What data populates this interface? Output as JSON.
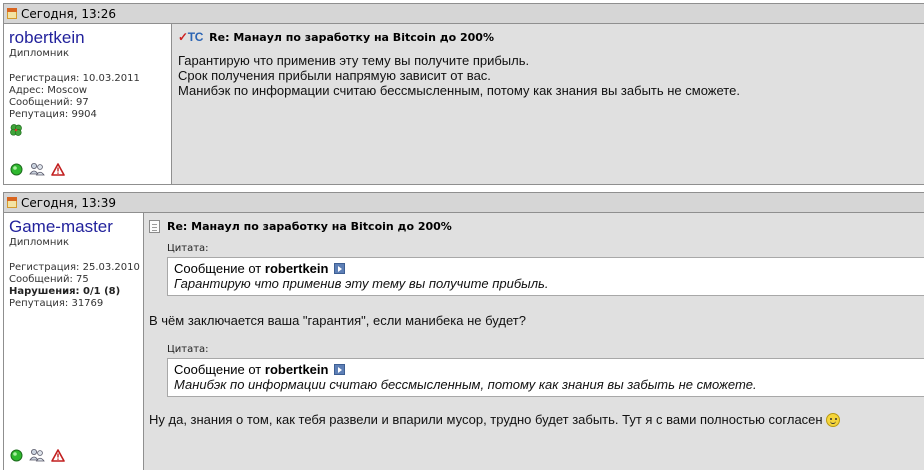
{
  "posts": [
    {
      "date": "Сегодня, 13:26",
      "username": "robertkein",
      "usertitle": "Дипломник",
      "stats": {
        "registration": "Регистрация: 10.03.2011",
        "address": "Адрес: Moscow",
        "messages": "Сообщений: 97",
        "reputation": "Репутация: 9904"
      },
      "tc_mark": "TC",
      "title": "Re: Манaул по заработку на Bitcoin до 200%",
      "lines": [
        "Гарантирую что применив эту тему вы получите прибыль.",
        "Срок получения прибыли напрямую зависит от вас.",
        "Манибэк по информации считаю бессмысленным, потому как знания вы забыть не сможете."
      ]
    },
    {
      "date": "Сегодня, 13:39",
      "username": "Game-master",
      "usertitle": "Дипломник",
      "stats": {
        "registration": "Регистрация: 25.03.2010",
        "messages": "Сообщений: 75",
        "violations": "Нарушения: 0/1 (8)",
        "reputation": "Репутация: 31769"
      },
      "title": "Re: Манaул по заработку на Bitcoin до 200%",
      "quote1": {
        "label": "Цитата:",
        "prefix": "Сообщение от",
        "author": "robertkein",
        "text": "Гарантирую что применив эту тему вы получите прибыль."
      },
      "text1": "В чём заключается ваша \"гарантия\", если манибека не будет?",
      "quote2": {
        "label": "Цитата:",
        "prefix": "Сообщение от",
        "author": "robertkein",
        "text": "Манибэк по информации считаю бессмысленным, потому как знания вы забыть не сможете."
      },
      "text2": "Ну да, знания о том, как тебя развели и впарили мусор, трудно будет забыть. Тут я с вами полностью согласен"
    }
  ],
  "icons": {
    "online": "online-status-icon",
    "users": "users-icon",
    "report": "report-warning-icon",
    "reputation": "reputation-clover-icon",
    "smiley": "smiley-icon"
  },
  "colors": {
    "header_bg": "#d6d6d6",
    "message_bg": "#e0e0e0",
    "username": "#22229c",
    "border": "#8f8f8f"
  }
}
